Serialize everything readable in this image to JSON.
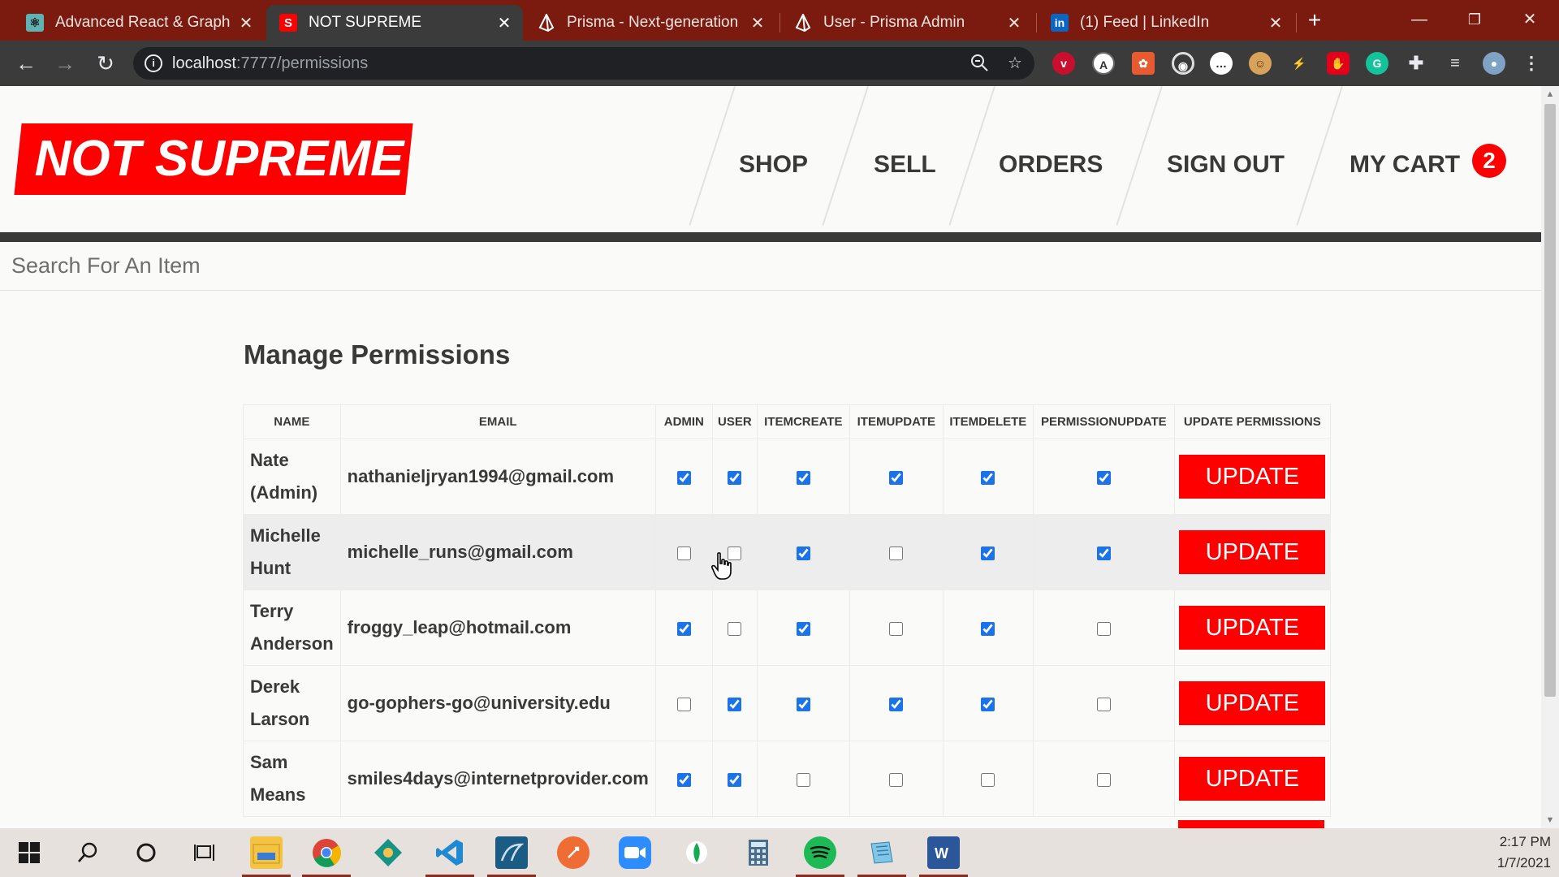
{
  "browser": {
    "tabs": [
      {
        "title": "Advanced React & GraphQL",
        "icon": "react-icon"
      },
      {
        "title": "NOT SUPREME",
        "icon": "s-icon",
        "favicon_text": "S",
        "active": true
      },
      {
        "title": "Prisma - Next-generation ORM",
        "icon": "prisma-icon"
      },
      {
        "title": "User - Prisma Admin",
        "icon": "prisma-icon"
      },
      {
        "title": "(1) Feed | LinkedIn",
        "icon": "linkedin-icon",
        "favicon_text": "in"
      }
    ],
    "new_tab": "+",
    "url_host": "localhost",
    "url_path": ":7777/permissions"
  },
  "site": {
    "logo": "NOT SUPREME",
    "nav": [
      {
        "label": "SHOP"
      },
      {
        "label": "SELL"
      },
      {
        "label": "ORDERS"
      },
      {
        "label": "SIGN OUT"
      },
      {
        "label": "MY CART"
      }
    ],
    "cart_count": "2",
    "search_placeholder": "Search For An Item"
  },
  "permissions": {
    "title": "Manage Permissions",
    "columns": [
      "NAME",
      "EMAIL",
      "ADMIN",
      "USER",
      "ITEMCREATE",
      "ITEMUPDATE",
      "ITEMDELETE",
      "PERMISSIONUPDATE",
      "UPDATE PERMISSIONS"
    ],
    "button_label": "UPDATE",
    "users": [
      {
        "name": "Nate (Admin)",
        "email": "nathanieljryan1994@gmail.com",
        "perms": [
          true,
          true,
          true,
          true,
          true,
          true
        ]
      },
      {
        "name": "Michelle Hunt",
        "email": "michelle_runs@gmail.com",
        "perms": [
          false,
          false,
          true,
          false,
          true,
          true
        ]
      },
      {
        "name": "Terry Anderson",
        "email": "froggy_leap@hotmail.com",
        "perms": [
          true,
          false,
          true,
          false,
          true,
          false
        ]
      },
      {
        "name": "Derek Larson",
        "email": "go-gophers-go@university.edu",
        "perms": [
          false,
          true,
          true,
          true,
          true,
          false
        ]
      },
      {
        "name": "Sam Means",
        "email": "smiles4days@internetprovider.com",
        "perms": [
          true,
          true,
          false,
          false,
          false,
          false
        ]
      }
    ]
  },
  "taskbar": {
    "time": "2:17 PM",
    "date": "1/7/2021",
    "apps": [
      "start-icon",
      "search-icon",
      "cortana-icon",
      "task-view-icon",
      "file-explorer-icon",
      "chrome-icon",
      "gitkraken-icon",
      "vscode-icon",
      "mysql-workbench-icon",
      "postman-icon",
      "zoom-icon",
      "mongodb-compass-icon",
      "calculator-icon",
      "spotify-icon",
      "notepad-icon",
      "word-icon"
    ]
  },
  "colors": {
    "brand_red": "#ff0000",
    "tab_strip": "#7b1a0e",
    "text_dark": "#393939",
    "checkbox_blue": "#1a73e8"
  }
}
